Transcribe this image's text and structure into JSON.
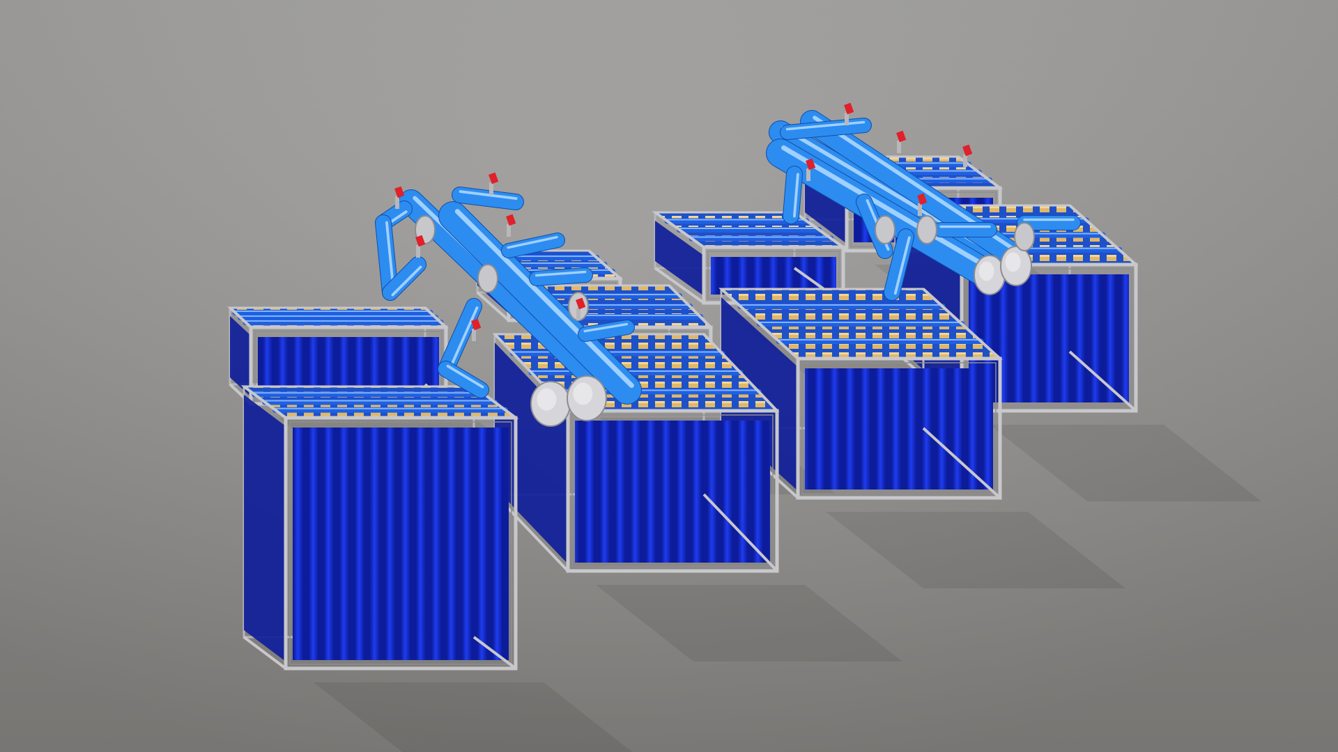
{
  "scene": {
    "subject": "membrane-bioreactor-cassette-array",
    "module_count": 9,
    "background_top": "#a4a3a1",
    "background_bottom": "#858380",
    "membrane_color": "#1830d8",
    "membrane_dark": "#0c1c9a",
    "pipe_color": "#2d8cf0",
    "pipe_dark": "#145ab4",
    "frame_color": "#c8c8cc",
    "header_color": "#d9ae5e",
    "valve_color": "#e0202a"
  }
}
